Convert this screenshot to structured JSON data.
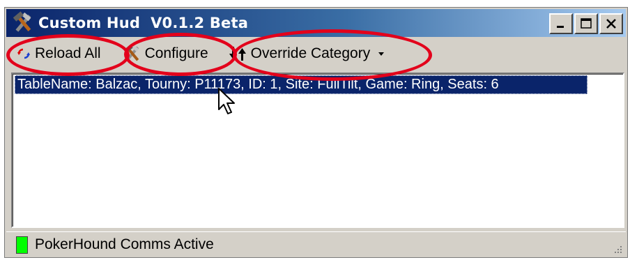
{
  "window": {
    "title": "Custom Hud  V0.1.2 Beta",
    "icon": "tools-icon",
    "controls": [
      "minimize-icon",
      "maximize-icon",
      "close-icon"
    ]
  },
  "toolbar": {
    "reload_label": "Reload All",
    "reload_icon": "refresh-arrows-icon",
    "configure_label": "Configure",
    "configure_icon": "tools-icon",
    "override_label": "Override Category",
    "override_icon": "sort-arrows-icon",
    "override_dropdown_icon": "chevron-down-icon"
  },
  "tables": {
    "rows": [
      "TableName: Balzac, Tourny: P11173, ID: 1, Site: FullTilt, Game: Ring, Seats: 6"
    ],
    "selected_index": 0
  },
  "status": {
    "text": "PokerHound Comms Active",
    "indicator_color": "#00ff00"
  },
  "colors": {
    "selection": "#0a246a",
    "annotation_ring": "#e3001b",
    "window_face": "#d4d0c8"
  }
}
